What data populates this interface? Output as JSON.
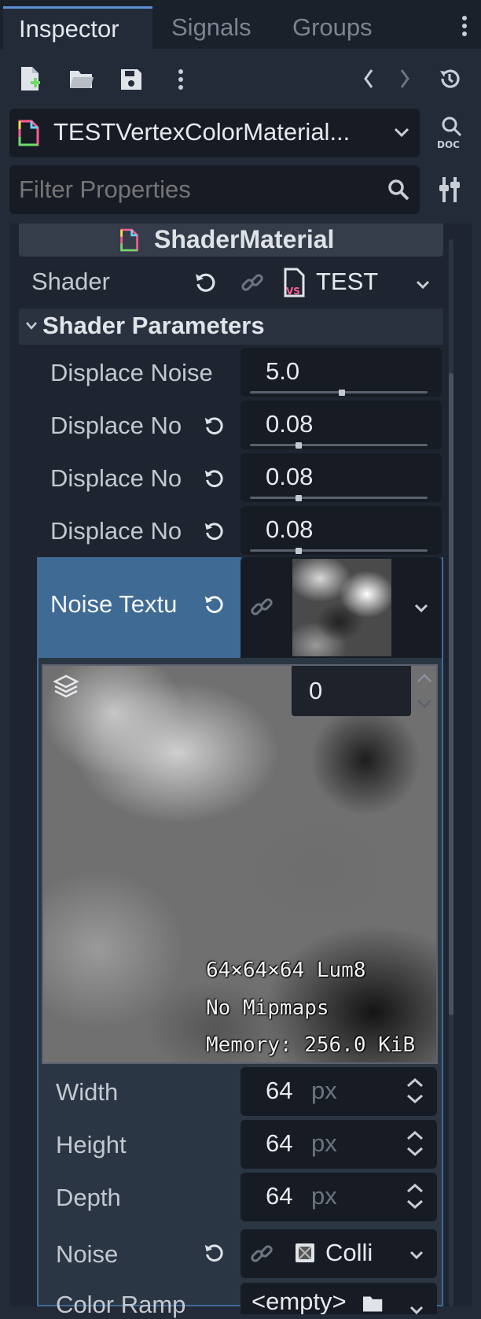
{
  "tabs": [
    "Inspector",
    "Signals",
    "Groups"
  ],
  "resource": {
    "name": "TESTVertexColorMaterial..."
  },
  "filter": {
    "placeholder": "Filter Properties"
  },
  "material": {
    "class_name": "ShaderMaterial"
  },
  "shader": {
    "label": "Shader",
    "value": "TEST"
  },
  "shader_params": {
    "header": "Shader Parameters",
    "rows": [
      {
        "label": "Displace Noise",
        "value": "5.0",
        "ratio": 0.52
      },
      {
        "label": "Displace No",
        "value": "0.08",
        "ratio": 0.28
      },
      {
        "label": "Displace No",
        "value": "0.08",
        "ratio": 0.28
      },
      {
        "label": "Displace No",
        "value": "0.08",
        "ratio": 0.28
      }
    ]
  },
  "noise_texture": {
    "label": "Noise Textu"
  },
  "preview": {
    "layer_value": "0",
    "info_line1": "64×64×64 Lum8",
    "info_line2": "No Mipmaps",
    "info_line3": "Memory: 256.0 KiB"
  },
  "dims": [
    {
      "label": "Width",
      "value": "64",
      "unit": "px"
    },
    {
      "label": "Height",
      "value": "64",
      "unit": "px"
    },
    {
      "label": "Depth",
      "value": "64",
      "unit": "px"
    }
  ],
  "noise": {
    "label": "Noise",
    "value": "Colli"
  },
  "color_ramp": {
    "label": "Color Ramp",
    "value": "<empty>"
  },
  "colors": {
    "accent": "#5e8fd6",
    "selected": "#3f6a94",
    "panel": "#232b38",
    "field": "#171c24"
  }
}
